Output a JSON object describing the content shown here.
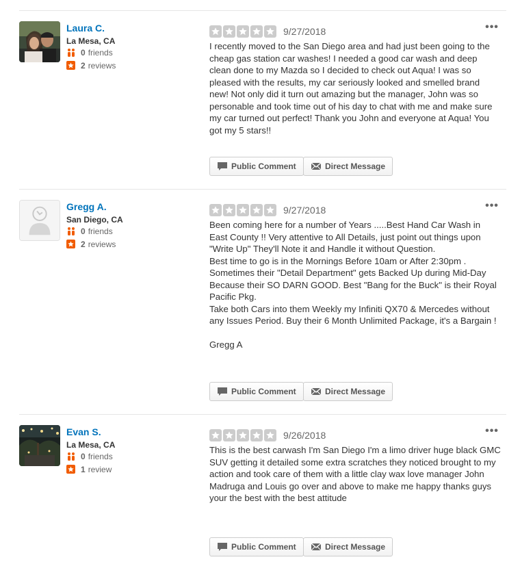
{
  "colors": {
    "link": "#0073bb",
    "star_empty": "#cccccc",
    "review_badge": "#f15c00",
    "divider": "#e6e6e6"
  },
  "reviews": [
    {
      "name": "Laura C.",
      "location": "La Mesa, CA",
      "friends_count": "0",
      "friends_label": "friends",
      "reviews_count": "2",
      "reviews_label": "reviews",
      "rating": 5,
      "date": "9/27/2018",
      "text": "I recently moved to the San Diego area and had just been going to the cheap gas station car washes! I needed a good car wash and deep clean done to my Mazda so I decided to check out Aqua! I was so pleased with the results, my car seriously looked and smelled brand new! Not only did it turn out amazing but the manager, John was so personable and took time out of his day to chat with me and make sure my car turned out perfect! Thank you John and everyone at Aqua! You got my 5 stars!!",
      "public_comment_label": "Public Comment",
      "direct_message_label": "Direct Message",
      "avatar": "photo-couple"
    },
    {
      "name": "Gregg A.",
      "location": "San Diego, CA",
      "friends_count": "0",
      "friends_label": "friends",
      "reviews_count": "2",
      "reviews_label": "reviews",
      "rating": 5,
      "date": "9/27/2018",
      "text": "Been coming here for a number of Years .....Best Hand Car Wash in East County !! Very attentive to All Details, just point out things upon \"Write Up\" They'll Note it and Handle it without Question.\nBest time to go is in the Mornings Before 10am or After 2:30pm .\n Sometimes their \"Detail Department\" gets Backed Up during Mid-Day Because their SO DARN  GOOD.  Best \"Bang for the Buck\" is their Royal Pacific Pkg.\nTake both Cars into them Weekly my Infiniti QX70 & Mercedes without  any Issues Period.  Buy their 6 Month Unlimited Package, it's a Bargain !\n\nGregg A",
      "public_comment_label": "Public Comment",
      "direct_message_label": "Direct Message",
      "avatar": "default-user-icon"
    },
    {
      "name": "Evan S.",
      "location": "La Mesa, CA",
      "friends_count": "0",
      "friends_label": "friends",
      "reviews_count": "1",
      "reviews_label": "review",
      "rating": 5,
      "date": "9/26/2018",
      "text": "This is the best carwash I'm San Diego  I'm a limo driver huge black GMC SUV  getting it detailed some extra scratches they noticed brought to my action and took care of them with a little clay wax love manager John Madruga and Louis go over and above  to make me happy thanks guys your the best with the best attitude",
      "public_comment_label": "Public Comment",
      "direct_message_label": "Direct Message",
      "avatar": "photo-night-scene"
    }
  ]
}
